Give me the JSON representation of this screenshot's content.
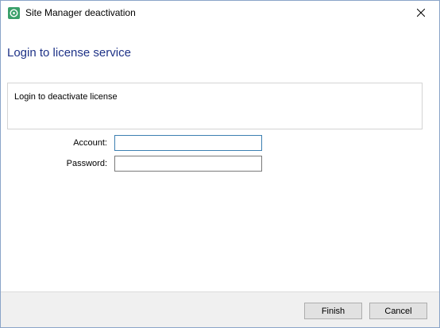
{
  "window": {
    "title": "Site Manager deactivation"
  },
  "page": {
    "heading": "Login to license service",
    "info_text": "Login to deactivate license"
  },
  "form": {
    "account_label": "Account:",
    "account_value": "",
    "password_label": "Password:",
    "password_value": ""
  },
  "footer": {
    "finish_label": "Finish",
    "cancel_label": "Cancel"
  },
  "colors": {
    "heading": "#1e3287",
    "icon_green": "#3aa06a",
    "footer_bg": "#f0f0f0",
    "focus_border": "#3c7fb1"
  },
  "icons": {
    "app": "app-logo-icon",
    "close": "close-icon"
  }
}
